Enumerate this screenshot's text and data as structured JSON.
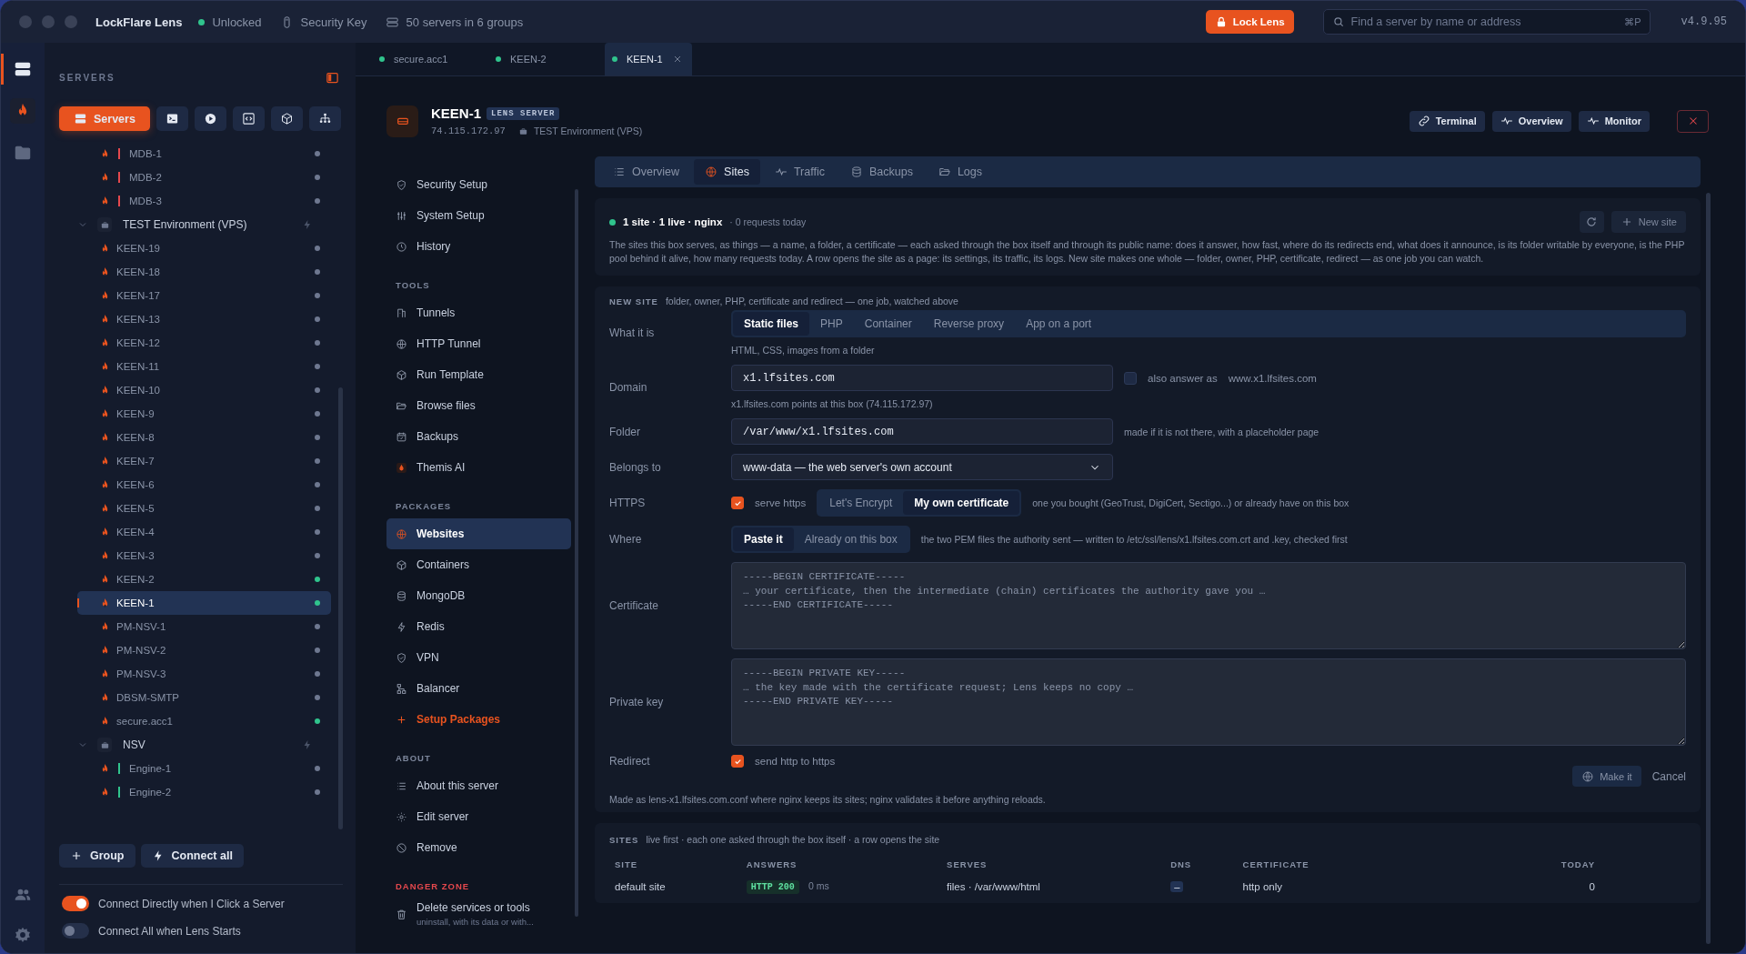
{
  "titlebar": {
    "app_name": "LockFlare Lens",
    "lock_status": "Unlocked",
    "unlocked": true,
    "key_label": "Security Key",
    "servers_summary": "50 servers in 6 groups",
    "lock_button": "Lock Lens",
    "search": {
      "placeholder": "Find a server by name or address",
      "shortcut": "⌘P"
    },
    "version": "v4.9.95"
  },
  "rail": [
    {
      "selected": true
    },
    {
      "selected": false
    },
    {
      "selected": false
    }
  ],
  "sidebar": {
    "title": "SERVERS",
    "modes": [
      {
        "label": "Servers",
        "selected": true
      },
      {
        "selected": false
      },
      {
        "selected": false
      },
      {
        "selected": false
      },
      {
        "selected": false
      },
      {
        "selected": false
      }
    ],
    "tree": [
      {
        "kind": "server",
        "name": "MDB-1",
        "color": "#e5484d",
        "online": false,
        "selected": false
      },
      {
        "kind": "server",
        "name": "MDB-2",
        "color": "#e5484d",
        "online": false,
        "selected": false
      },
      {
        "kind": "server",
        "name": "MDB-3",
        "color": "#e5484d",
        "online": false,
        "selected": false
      },
      {
        "kind": "group",
        "name": "TEST Environment (VPS)",
        "expanded": true,
        "children": [
          {
            "kind": "server",
            "name": "KEEN-19",
            "online": false,
            "selected": false
          },
          {
            "kind": "server",
            "name": "KEEN-18",
            "online": false,
            "selected": false
          },
          {
            "kind": "server",
            "name": "KEEN-17",
            "online": false,
            "selected": false
          },
          {
            "kind": "server",
            "name": "KEEN-13",
            "online": false,
            "selected": false
          },
          {
            "kind": "server",
            "name": "KEEN-12",
            "online": false,
            "selected": false
          },
          {
            "kind": "server",
            "name": "KEEN-11",
            "online": false,
            "selected": false
          },
          {
            "kind": "server",
            "name": "KEEN-10",
            "online": false,
            "selected": false
          },
          {
            "kind": "server",
            "name": "KEEN-9",
            "online": false,
            "selected": false
          },
          {
            "kind": "server",
            "name": "KEEN-8",
            "online": false,
            "selected": false
          },
          {
            "kind": "server",
            "name": "KEEN-7",
            "online": false,
            "selected": false
          },
          {
            "kind": "server",
            "name": "KEEN-6",
            "online": false,
            "selected": false
          },
          {
            "kind": "server",
            "name": "KEEN-5",
            "online": false,
            "selected": false
          },
          {
            "kind": "server",
            "name": "KEEN-4",
            "online": false,
            "selected": false
          },
          {
            "kind": "server",
            "name": "KEEN-3",
            "online": false,
            "selected": false
          },
          {
            "kind": "server",
            "name": "KEEN-2",
            "online": true,
            "selected": false
          },
          {
            "kind": "server",
            "name": "KEEN-1",
            "online": true,
            "selected": true
          },
          {
            "kind": "server",
            "name": "PM-NSV-1",
            "online": false,
            "selected": false
          },
          {
            "kind": "server",
            "name": "PM-NSV-2",
            "online": false,
            "selected": false
          },
          {
            "kind": "server",
            "name": "PM-NSV-3",
            "online": false,
            "selected": false
          },
          {
            "kind": "server",
            "name": "DBSM-SMTP",
            "online": false,
            "selected": false
          },
          {
            "kind": "server",
            "name": "secure.acc1",
            "online": true,
            "selected": false
          }
        ]
      },
      {
        "kind": "group",
        "name": "NSV",
        "expanded": true,
        "children": [
          {
            "kind": "server",
            "name": "Engine-1",
            "color": "#30c48d",
            "online": false,
            "selected": false
          },
          {
            "kind": "server",
            "name": "Engine-2",
            "color": "#30c48d",
            "online": false,
            "selected": false
          }
        ]
      }
    ],
    "buttons": [
      "Group",
      "Connect all"
    ],
    "toggles": [
      {
        "label": "Connect Directly when I Click a Server",
        "on": true
      },
      {
        "label": "Connect All when Lens Starts",
        "on": false
      }
    ]
  },
  "tabs": [
    {
      "label": "secure.acc1",
      "online": true,
      "selected": false
    },
    {
      "label": "KEEN-2",
      "online": true,
      "selected": false
    },
    {
      "label": "KEEN-1",
      "online": true,
      "selected": true
    }
  ],
  "server": {
    "name": "KEEN-1",
    "badge": "LENS SERVER",
    "address": "74.115.172.97",
    "group": "TEST Environment (VPS)",
    "actions": [
      "Terminal",
      "Overview",
      "Monitor"
    ]
  },
  "nav": [
    {
      "items": [
        {
          "label": "Security Setup",
          "selected": false
        },
        {
          "label": "System Setup",
          "selected": false
        },
        {
          "label": "History",
          "selected": false
        }
      ]
    },
    {
      "heading": "TOOLS",
      "items": [
        {
          "label": "Tunnels",
          "selected": false
        },
        {
          "label": "HTTP Tunnel",
          "selected": false
        },
        {
          "label": "Run Template",
          "selected": false
        },
        {
          "label": "Browse files",
          "selected": false
        },
        {
          "label": "Backups",
          "selected": false
        },
        {
          "label": "Themis AI",
          "selected": false
        }
      ]
    },
    {
      "heading": "PACKAGES",
      "items": [
        {
          "label": "Websites",
          "selected": true
        },
        {
          "label": "Containers",
          "selected": false
        },
        {
          "label": "MongoDB",
          "selected": false
        },
        {
          "label": "Redis",
          "selected": false
        },
        {
          "label": "VPN",
          "selected": false
        },
        {
          "label": "Balancer",
          "selected": false
        },
        {
          "label": "Setup Packages",
          "kind": "add",
          "selected": false
        }
      ]
    },
    {
      "heading": "ABOUT",
      "items": [
        {
          "label": "About this server",
          "selected": false
        },
        {
          "label": "Edit server",
          "selected": false
        },
        {
          "label": "Remove",
          "selected": false
        }
      ]
    },
    {
      "heading": "DANGER ZONE",
      "kind": "danger",
      "items": [
        {
          "label": "Delete services or tools",
          "subtitle": "uninstall, with its data or with...",
          "selected": false
        }
      ]
    }
  ],
  "page_tabs": [
    {
      "label": "Overview",
      "selected": false
    },
    {
      "label": "Sites",
      "selected": true
    },
    {
      "label": "Traffic",
      "selected": false
    },
    {
      "label": "Backups",
      "selected": false
    },
    {
      "label": "Logs",
      "selected": false
    }
  ],
  "summary": {
    "title": "1 site · 1 live · nginx",
    "note": "· 0 requests today",
    "live": true,
    "description": "The sites this box serves, as things — a name, a folder, a certificate — each asked through the box itself and through its public name: does it answer, how fast, where do its redirects end, what does it announce, is its folder writable by everyone, is the PHP pool behind it alive, how many requests today. A row opens the site as a page: its settings, its traffic, its logs. New site makes one whole — folder, owner, PHP, certificate, redirect — as one job you can watch.",
    "new_button": "New site"
  },
  "new_site": {
    "heading": "NEW SITE",
    "note": "folder, owner, PHP, certificate and redirect — one job, watched above",
    "kind": {
      "label": "What it is",
      "options": [
        {
          "label": "Static files",
          "selected": true
        },
        {
          "label": "PHP",
          "selected": false
        },
        {
          "label": "Container",
          "selected": false
        },
        {
          "label": "Reverse proxy",
          "selected": false
        },
        {
          "label": "App on a port",
          "selected": false
        }
      ],
      "hint": "HTML, CSS, images from a folder"
    },
    "domain": {
      "label": "Domain",
      "value": "x1.lfsites.com",
      "also_checked": false,
      "also_label": "also answer as",
      "also_value": "www.x1.lfsites.com",
      "hint": "x1.lfsites.com points at this box (74.115.172.97)"
    },
    "folder": {
      "label": "Folder",
      "value": "/var/www/x1.lfsites.com",
      "hint": "made if it is not there, with a placeholder page"
    },
    "owner": {
      "label": "Belongs to",
      "value": "www-data — the web server's own account"
    },
    "https": {
      "label": "HTTPS",
      "checked": true,
      "check_label": "serve https",
      "options": [
        {
          "label": "Let's Encrypt",
          "selected": false
        },
        {
          "label": "My own certificate",
          "selected": true
        }
      ],
      "hint": "one you bought (GeoTrust, DigiCert, Sectigo...) or already have on this box"
    },
    "where": {
      "label": "Where",
      "options": [
        {
          "label": "Paste it",
          "selected": true
        },
        {
          "label": "Already on this box",
          "selected": false
        }
      ],
      "hint": "the two PEM files the authority sent — written to /etc/ssl/lens/x1.lfsites.com.crt and .key, checked first"
    },
    "certificate": {
      "label": "Certificate",
      "placeholder": "-----BEGIN CERTIFICATE-----\n… your certificate, then the intermediate (chain) certificates the authority gave you …\n-----END CERTIFICATE-----"
    },
    "private_key": {
      "label": "Private key",
      "placeholder": "-----BEGIN PRIVATE KEY-----\n… the key made with the certificate request; Lens keeps no copy …\n-----END PRIVATE KEY-----"
    },
    "redirect": {
      "label": "Redirect",
      "checked": true,
      "check_label": "send http to https"
    },
    "submit": "Make it",
    "cancel": "Cancel",
    "footnote": "Made as lens-x1.lfsites.com.conf where nginx keeps its sites; nginx validates it before anything reloads."
  },
  "sites": {
    "heading": "SITES",
    "note": "live first · each one asked through the box itself · a row opens the site",
    "columns": [
      "SITE",
      "ANSWERS",
      "SERVES",
      "DNS",
      "CERTIFICATE",
      "TODAY"
    ],
    "rows": [
      {
        "site": "default site",
        "status": "HTTP 200",
        "ok": true,
        "time": "0 ms",
        "serves": "files · /var/www/html",
        "dns": "–",
        "certificate": "http only",
        "today": "0"
      }
    ]
  }
}
